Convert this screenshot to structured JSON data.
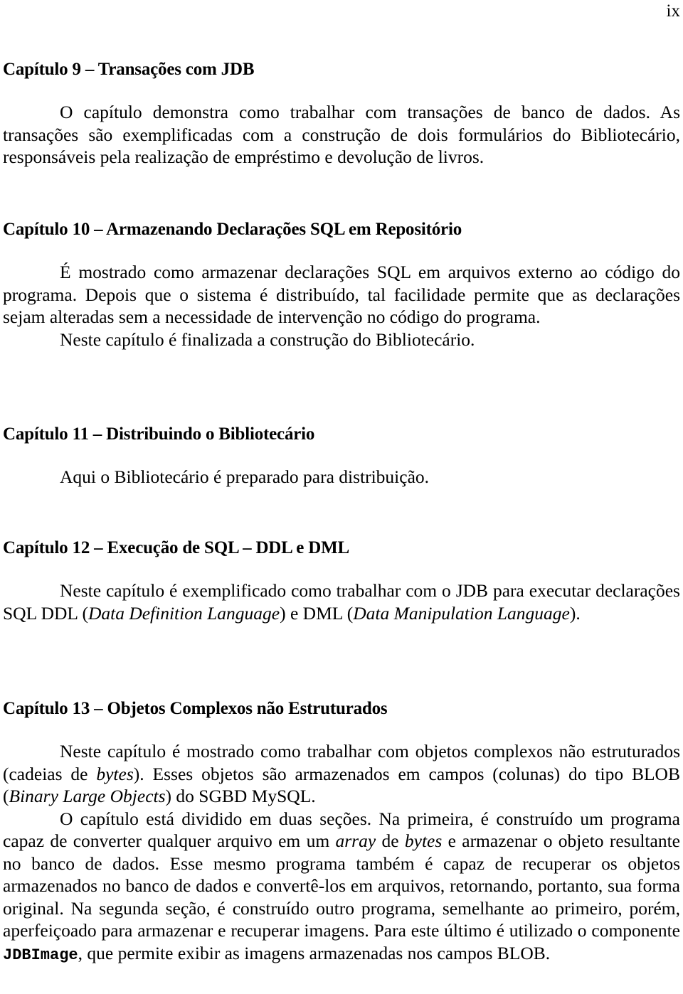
{
  "page_number": "ix",
  "chapters": [
    {
      "title": "Capítulo 9 – Transações com JDB",
      "paragraphs": [
        "O capítulo demonstra como trabalhar com transações de banco de dados. As transações são exemplificadas com a construção de dois formulários do Bibliotecário, responsáveis pela realização de empréstimo e devolução de livros."
      ]
    },
    {
      "title": "Capítulo 10 – Armazenando Declarações SQL em Repositório",
      "paragraphs": [
        "É mostrado como armazenar declarações SQL em arquivos externo ao código do programa. Depois que o sistema é distribuído, tal facilidade permite que as declarações sejam alteradas sem a necessidade de intervenção no código do programa.",
        "Neste capítulo é finalizada a construção do Bibliotecário."
      ]
    },
    {
      "title": "Capítulo 11 – Distribuindo o Bibliotecário",
      "paragraphs": [
        "Aqui o Bibliotecário é preparado para distribuição."
      ]
    },
    {
      "title": "Capítulo 12 – Execução de SQL – DDL e DML",
      "p1": {
        "a": "Neste capítulo é exemplificado como trabalhar com o JDB para executar declarações SQL DDL (",
        "i1": "Data Definition Language",
        "b": ") e DML (",
        "i2": "Data Manipulation Language",
        "c": ")."
      }
    },
    {
      "title": "Capítulo 13 – Objetos Complexos não Estruturados",
      "p1": {
        "a": "Neste capítulo é mostrado como trabalhar com objetos complexos não estruturados (cadeias de ",
        "i1": "bytes",
        "b": "). Esses objetos são armazenados em campos (colunas) do tipo BLOB (",
        "i2": "Binary Large Objects",
        "c": ") do SGBD MySQL."
      },
      "p2": {
        "a": "O capítulo está dividido em duas seções. Na primeira, é construído um programa capaz de converter qualquer arquivo em um ",
        "i1": "array",
        "b": " de ",
        "i2": "bytes",
        "c": " e armazenar o objeto resultante no banco de dados. Esse mesmo programa também é capaz de recuperar os objetos armazenados no banco de dados e convertê-los em arquivos, retornando, portanto, sua forma original. Na segunda seção, é construído outro programa, semelhante ao primeiro, porém, aperfeiçoado para armazenar e recuperar imagens. Para este último é utilizado o componente ",
        "code": "JDBImage",
        "d": ", que permite exibir as imagens armazenadas nos campos BLOB."
      }
    }
  ]
}
